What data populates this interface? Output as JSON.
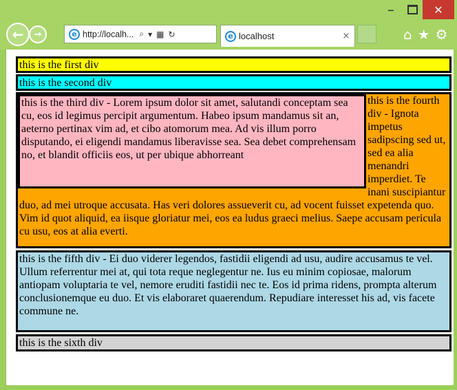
{
  "window": {
    "minimize": "–",
    "maximize": "",
    "close": "✕"
  },
  "toolbar": {
    "address_url": "http://localh...",
    "tab_title": "localhost",
    "tab_close": "×",
    "icons": [
      "home-icon",
      "favorites-star-icon",
      "settings-gear-icon"
    ]
  },
  "page": {
    "div1": "this is the first div",
    "div2": "this is the second div",
    "div3": "this is the third div - Lorem ipsum dolor sit amet, salutandi conceptam sea cu, eos id legimus percipit argumentum. Habeo ipsum mandamus sit an, aeterno pertinax vim ad, et cibo atomorum mea. Ad vis illum porro disputando, ei eligendi mandamus liberavisse sea. Sea debet comprehensam no, et blandit officiis eos, ut per ubique abhorreant",
    "div4": "this is the fourth div - Ignota impetus sadipscing sed ut, sed ea alia menandri imperdiet. Te inani suscipiantur duo, ad mei utroque accusata. Has veri dolores assueverit cu, ad vocent fuisset expetenda quo. Vim id quot aliquid, ea iisque gloriatur mei, eos ea ludus graeci melius. Saepe accusam pericula cu usu, eos at alia everti.",
    "div5": "this is the fifth div - Ei duo viderer legendos, fastidii eligendi ad usu, audire accusamus te vel. Ullum referrentur mei at, qui tota reque neglegentur ne. Ius eu minim copiosae, malorum antiopam voluptaria te vel, nemore eruditi fastidii nec te. Eos id prima ridens, prompta alterum conclusionemque eu duo. Et vis elaboraret quaerendum. Repudiare interesset his ad, vis facete commune ne.",
    "div6": "this is the sixth div"
  },
  "colors": {
    "chrome": "#a6d465",
    "div1": "#ffff00",
    "div2": "#00ffff",
    "div3": "#ffb6c1",
    "div4": "#ffa500",
    "div5": "#add8e6",
    "div6": "#d3d3d3"
  }
}
